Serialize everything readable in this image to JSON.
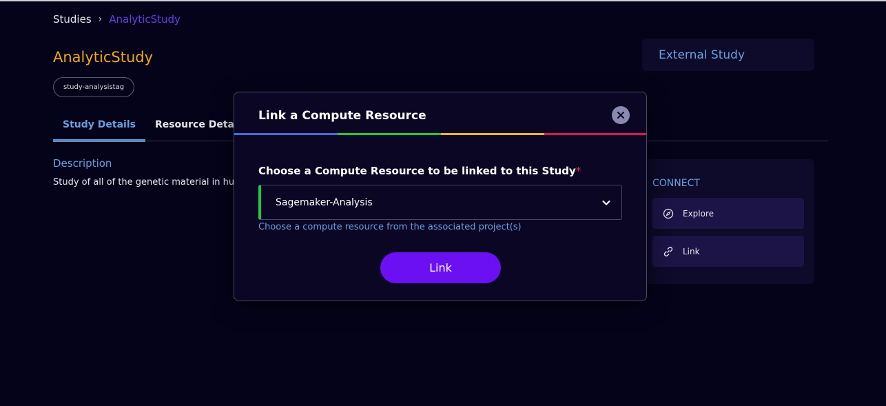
{
  "breadcrumb": {
    "root": "Studies",
    "separator": "›",
    "current": "AnalyticStudy"
  },
  "page_title": "AnalyticStudy",
  "tag": "study-analysistag",
  "external_card": {
    "label": "External Study"
  },
  "tabs": [
    {
      "label": "Study Details",
      "active": true
    },
    {
      "label": "Resource Details",
      "active": false
    }
  ],
  "description": {
    "heading": "Description",
    "text": "Study of all of the genetic material in hum"
  },
  "connect": {
    "title": "CONNECT",
    "explore_label": "Explore",
    "link_label": "Link"
  },
  "modal": {
    "title": "Link a Compute Resource",
    "field_label": "Choose a Compute Resource to be linked to this Study",
    "required_marker": "*",
    "selected_value": "Sagemaker-Analysis",
    "helper_text": "Choose a compute resource from the associated project(s)",
    "submit_label": "Link",
    "rainbow_colors": [
      "#3b6fe0",
      "#1bc94b",
      "#f2b51e",
      "#e0144c"
    ]
  },
  "colors": {
    "background": "#05031a",
    "accent_blue": "#6aa0df",
    "title_orange": "#f2a81e",
    "breadcrumb_purple": "#6b3ee6",
    "primary_button": "#6b10f2"
  }
}
